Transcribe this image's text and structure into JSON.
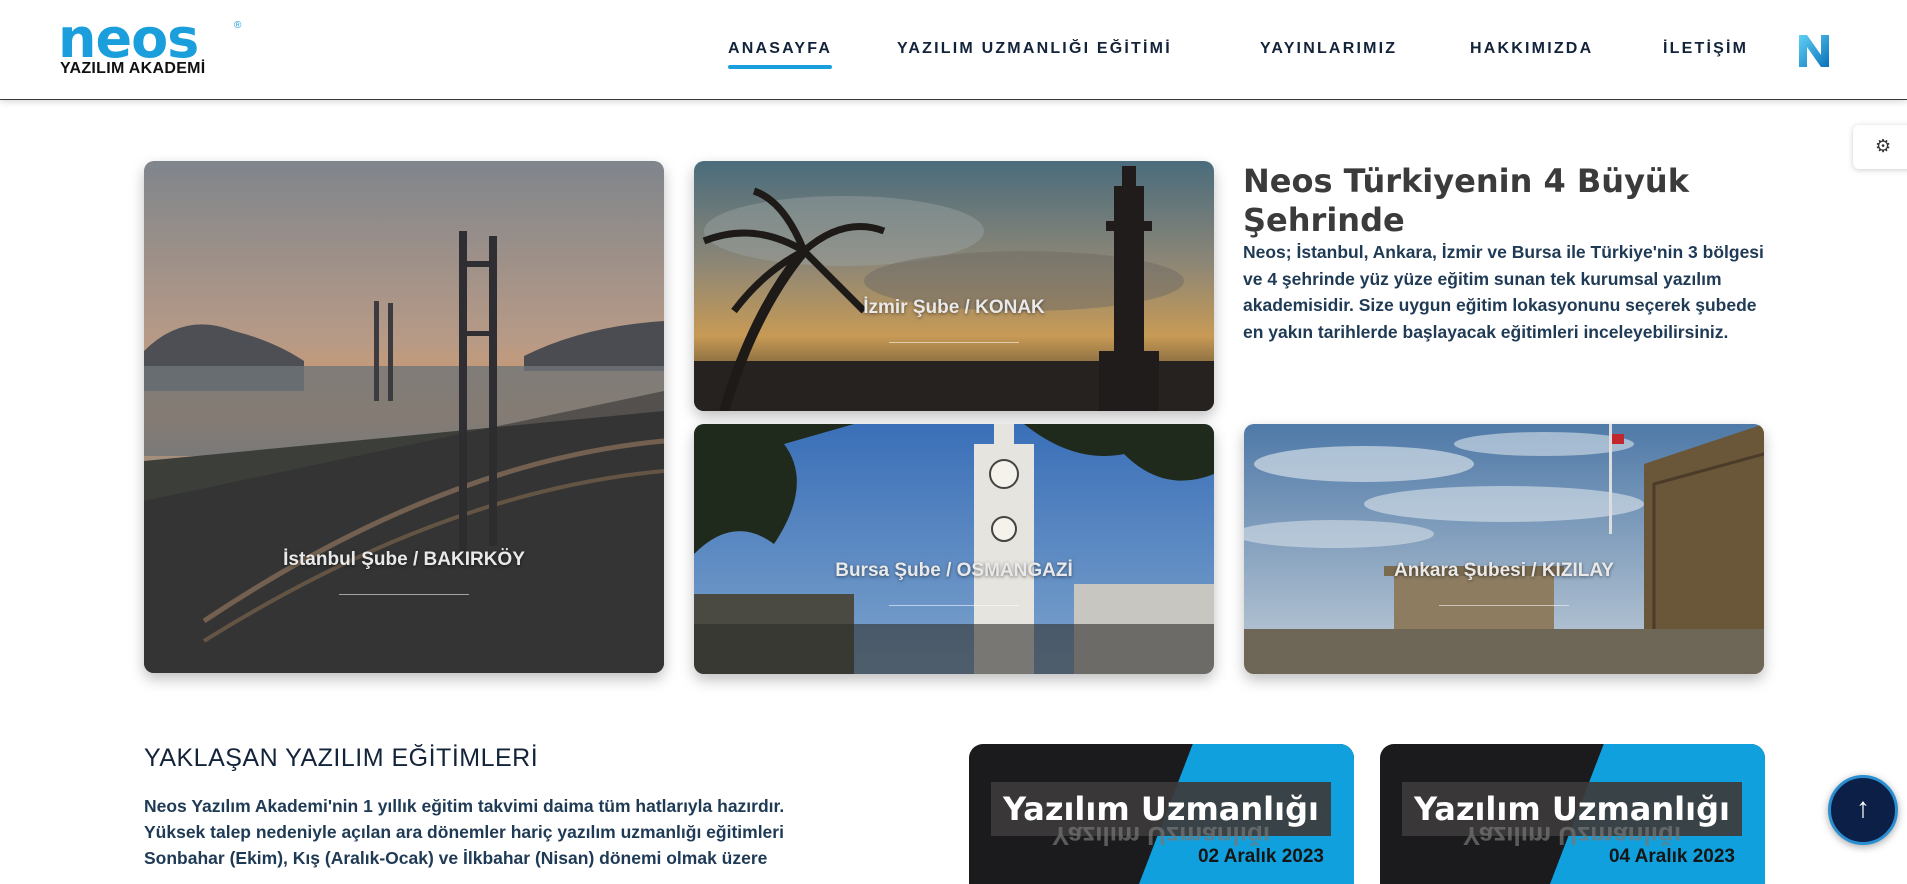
{
  "header": {
    "logo": {
      "brand": "neos",
      "subtitle": "YAZILIM AKADEMİ"
    },
    "nav": [
      {
        "label": "ANASAYFA"
      },
      {
        "label": "YAZILIM UZMANLIĞI EĞİTİMİ"
      },
      {
        "label": "YAYINLARIMIZ"
      },
      {
        "label": "HAKKIMIZDA"
      },
      {
        "label": "İLETİŞİM"
      }
    ]
  },
  "branches": {
    "istanbul": "İstanbul Şube / BAKIRKÖY",
    "izmir": "İzmir Şube / KONAK",
    "bursa": "Bursa Şube / OSMANGAZİ",
    "ankara": "Ankara Şubesi / KIZILAY"
  },
  "intro": {
    "title": "Neos Türkiyenin 4 Büyük Şehrinde",
    "text": "Neos; İstanbul, Ankara, İzmir ve Bursa ile Türkiye'nin 3 bölgesi ve 4 şehrinde yüz yüze eğitim sunan tek kurumsal yazılım akademisidir. Size uygun eğitim lokasyonunu seçerek şubede en yakın tarihlerde başlayacak eğitimleri inceleyebilirsiniz."
  },
  "upcoming": {
    "title": "YAKLAŞAN YAZILIM EĞİTİMLERİ",
    "text": "Neos Yazılım Akademi'nin 1 yıllık eğitim takvimi daima tüm hatlarıyla hazırdır. Yüksek talep nedeniyle açılan ara dönemler hariç yazılım uzmanlığı eğitimleri Sonbahar (Ekim), Kış (Aralık-Ocak) ve İlkbahar (Nisan) dönemi olmak üzere"
  },
  "courses": [
    {
      "title": "Yazılım Uzmanlığı",
      "date": "02 Aralık 2023"
    },
    {
      "title": "Yazılım Uzmanlığı",
      "date": "04 Aralık 2023"
    }
  ],
  "colors": {
    "accent": "#1a9fdc",
    "navText": "#13233a",
    "courseDark": "#1b1b1d"
  },
  "icons": {
    "settings": "gear-icon",
    "backToTop": "arrow-up-icon",
    "brand": "n-logo-icon"
  }
}
